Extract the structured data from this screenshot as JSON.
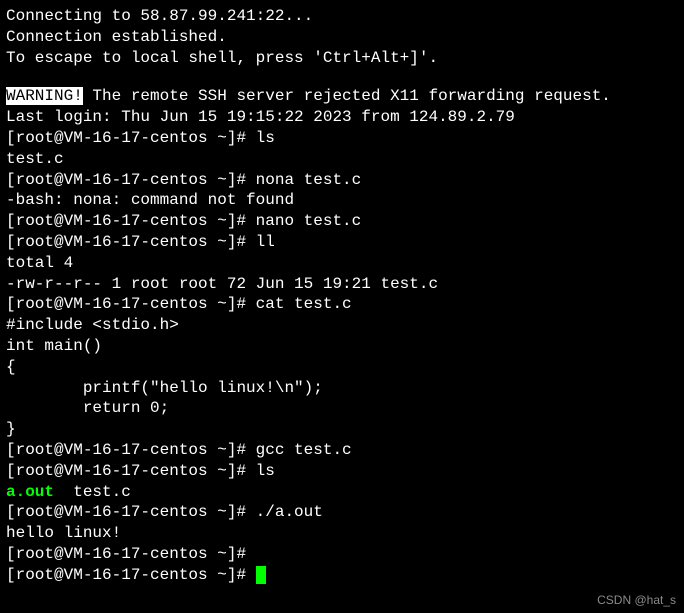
{
  "l1": "Connecting to 58.87.99.241:22...",
  "l2": "Connection established.",
  "l3": "To escape to local shell, press 'Ctrl+Alt+]'.",
  "warn": "WARNING!",
  "l4": " The remote SSH server rejected X11 forwarding request.",
  "l5": "Last login: Thu Jun 15 19:15:22 2023 from 124.89.2.79",
  "prompt": "[root@VM-16-17-centos ~]# ",
  "c1": "ls",
  "o1": "test.c",
  "c2": "nona test.c",
  "o2": "-bash: nona: command not found",
  "c3": "nano test.c",
  "c4": "ll",
  "o4a": "total 4",
  "o4b": "-rw-r--r-- 1 root root 72 Jun 15 19:21 test.c",
  "c5": "cat test.c",
  "src1": "#include <stdio.h>",
  "src2": "int main()",
  "src3": "{",
  "src4": "        printf(\"hello linux!\\n\");",
  "src5": "        return 0;",
  "src6": "}",
  "c6": "gcc test.c",
  "c7": "ls",
  "aout": "a.out",
  "aout_rest": "  test.c",
  "c8": "./a.out",
  "o8": "hello linux!",
  "watermark": "CSDN @hat_s"
}
